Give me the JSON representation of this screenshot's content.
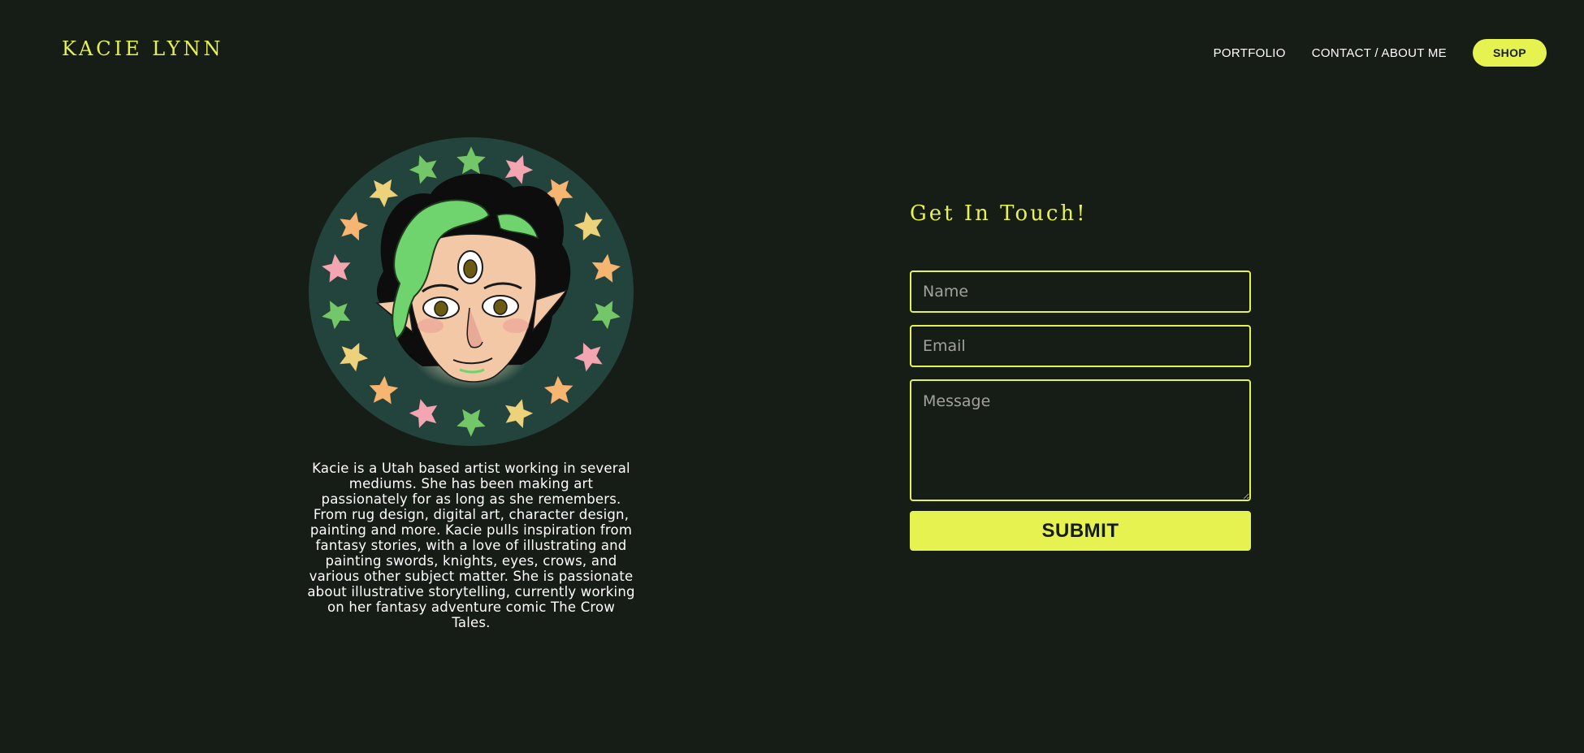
{
  "header": {
    "logo": "KACIE LYNN",
    "nav": [
      {
        "label": "PORTFOLIO"
      },
      {
        "label": "CONTACT / ABOUT ME"
      }
    ],
    "shop_label": "SHOP"
  },
  "about": {
    "bio": "Kacie is a Utah based artist working in several mediums. She has been making art passionately for as long as she remembers. From rug design, digital art, character design, painting and more. Kacie pulls inspiration from fantasy stories, with a love of illustrating and painting swords, knights, eyes, crows, and various other subject matter. She is passionate about illustrative storytelling, currently working on her fantasy adventure comic The Crow Tales."
  },
  "contact": {
    "title": "Get In Touch!",
    "name_placeholder": "Name",
    "email_placeholder": "Email",
    "message_placeholder": "Message",
    "submit_label": "SUBMIT"
  },
  "colors": {
    "background": "#161c16",
    "accent": "#e6f24f",
    "text": "#ffffff",
    "avatar_bg": "#23433d",
    "star_green": "#74c768",
    "star_pink": "#f3a6b1",
    "star_orange": "#f7b572",
    "star_yellow": "#ecd27b",
    "hair_green": "#6fd46e"
  }
}
